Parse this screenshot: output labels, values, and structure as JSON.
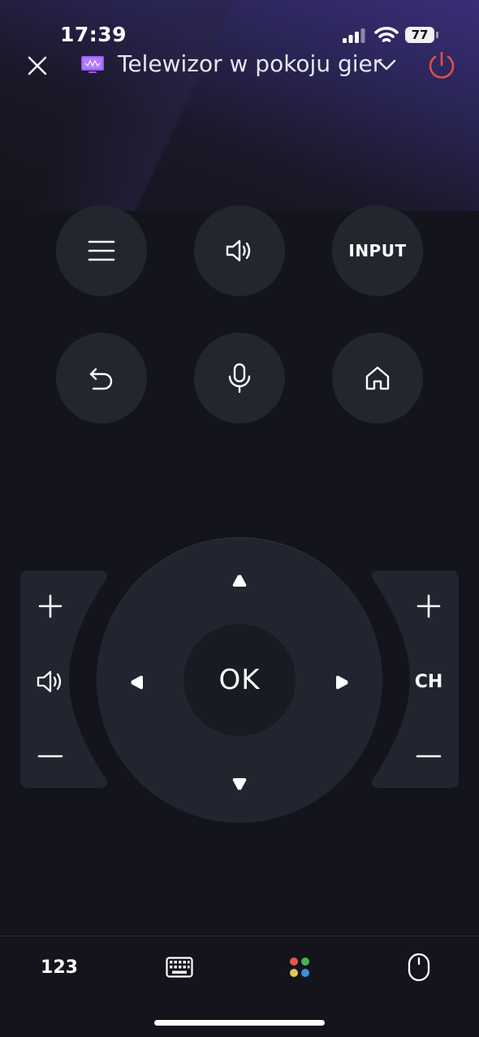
{
  "status_bar": {
    "time": "17:39",
    "battery_level": "77",
    "signal_icon": "cellular-signal-icon",
    "wifi_icon": "wifi-icon"
  },
  "header": {
    "close_icon": "close-icon",
    "device_icon": "tv-icon",
    "device_name": "Telewizor w pokoju gier",
    "dropdown_icon": "chevron-down-icon",
    "power_icon": "power-icon",
    "power_color": "#e0504a"
  },
  "buttons": {
    "menu_icon": "menu-icon",
    "sound_icon": "speaker-icon",
    "input_label": "INPUT",
    "back_icon": "back-icon",
    "voice_icon": "microphone-icon",
    "home_icon": "home-icon"
  },
  "volume_rocker": {
    "up_icon": "plus-icon",
    "center_icon": "speaker-icon",
    "down_icon": "minus-icon"
  },
  "channel_rocker": {
    "up_icon": "plus-icon",
    "label": "CH",
    "down_icon": "minus-icon"
  },
  "dpad": {
    "ok_label": "OK",
    "up_icon": "arrow-up-icon",
    "down_icon": "arrow-down-icon",
    "left_icon": "arrow-left-icon",
    "right_icon": "arrow-right-icon"
  },
  "bottom_bar": {
    "numpad_label": "123",
    "keyboard_icon": "keyboard-icon",
    "apps_icon": "apps-dots-icon",
    "mouse_icon": "mouse-icon",
    "dot_colors": [
      "#e05a4a",
      "#4caf50",
      "#e8c25a",
      "#3d8fe0"
    ]
  },
  "colors": {
    "background": "#14141c",
    "button": "#23252f",
    "accent_gradient": "#3a2e78"
  }
}
